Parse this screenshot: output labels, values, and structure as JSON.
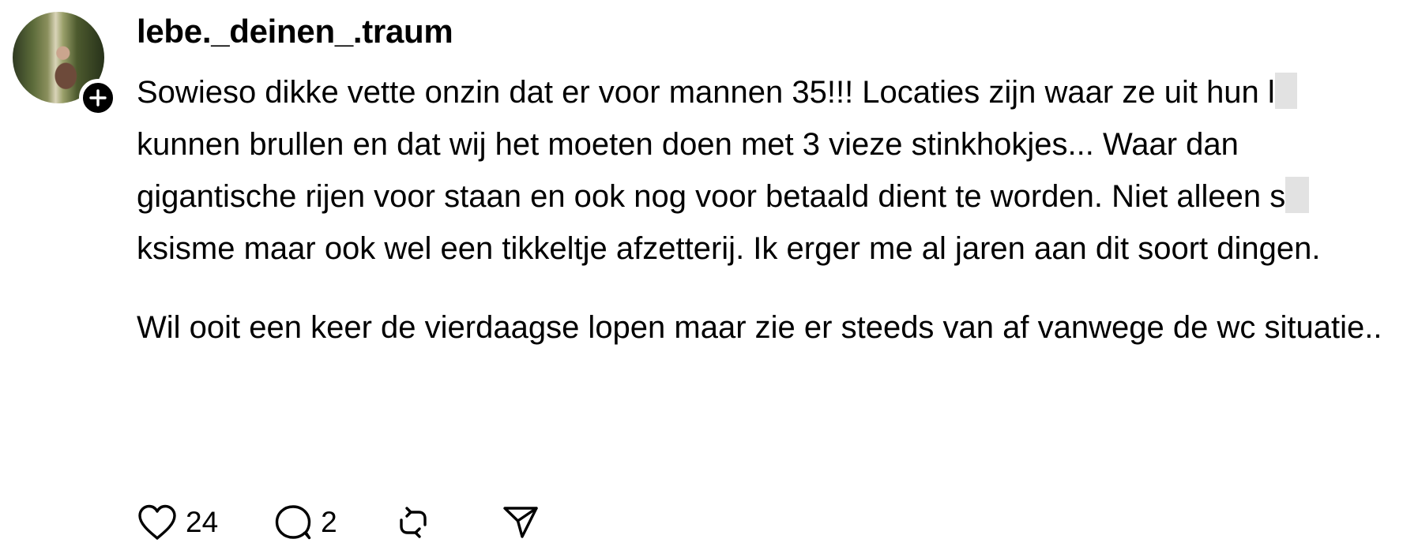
{
  "post": {
    "username": "lebe._deinen_.traum",
    "paragraphs": [
      [
        {
          "text": "Sowieso dikke vette onzin dat er voor mannen 35!!! Locaties zijn waar ze uit hun l"
        },
        {
          "redacted": true
        },
        {
          "text": " kunnen brullen en dat wij het moeten doen met 3 vieze stinkhokjes... Waar dan gigantische rijen voor staan en ook nog voor betaald dient te worden. Niet alleen s"
        },
        {
          "redacted": true
        },
        {
          "text": "ksisme maar ook wel een tikkeltje afzetterij. Ik erger me al jaren aan dit soort dingen."
        }
      ],
      [
        {
          "text": "Wil ooit een keer de vierdaagse lopen maar zie er steeds van af vanwege de wc situatie.."
        }
      ]
    ],
    "actions": {
      "likes": "24",
      "replies": "2"
    }
  },
  "icons": {
    "like": "heart-icon",
    "reply": "speech-bubble-icon",
    "repost": "repost-icon",
    "share": "paper-plane-icon",
    "follow": "plus-icon"
  },
  "colors": {
    "text": "#000000",
    "redaction": "#e2e2e2",
    "background": "#ffffff"
  }
}
